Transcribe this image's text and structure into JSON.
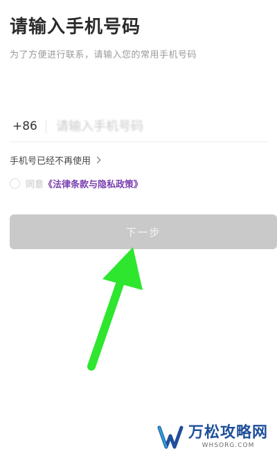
{
  "header": {
    "title": "请输入手机号码",
    "subtitle": "为了方便进行联系，请输入您的常用手机号码"
  },
  "phone": {
    "country_code": "+86",
    "placeholder": "请输入手机号码",
    "value": ""
  },
  "links": {
    "no_longer_used": "手机号已经不再使用",
    "chevron_icon": "chevron-right-icon"
  },
  "agreement": {
    "prefix": "同意",
    "policy": "《法律条款与隐私政策》",
    "checked": false
  },
  "actions": {
    "next_label": "下一步"
  },
  "watermark": {
    "title": "万松攻略网",
    "url": "WHSORG.COM"
  },
  "colors": {
    "arrow": "#2ee62e",
    "button_disabled": "#c9c9c9",
    "policy_link": "#7a3fb0",
    "watermark_brand": "#1f4f9b"
  }
}
